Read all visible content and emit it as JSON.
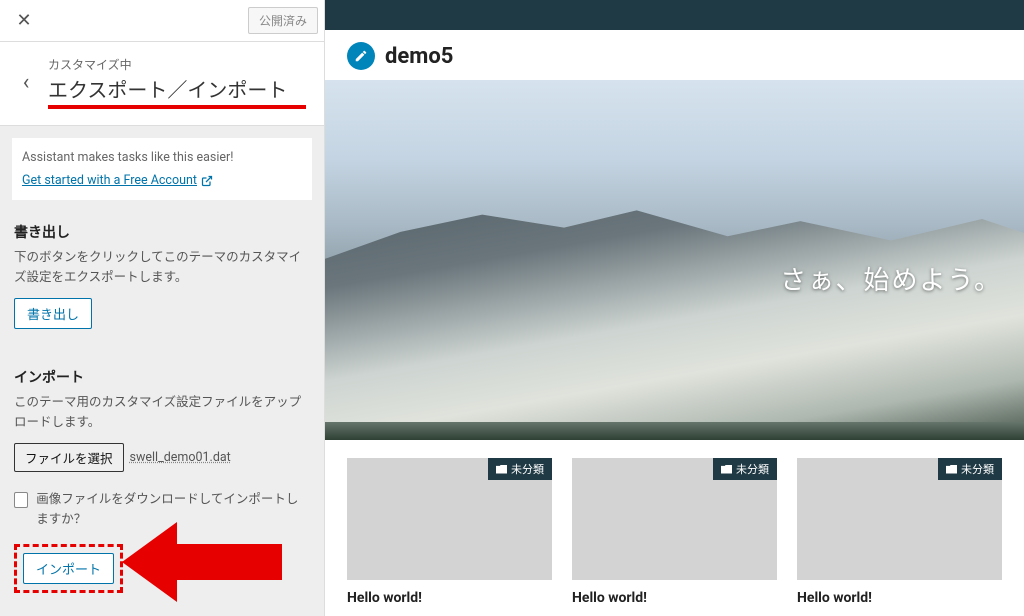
{
  "header": {
    "publish_label": "公開済み"
  },
  "panel": {
    "breadcrumb": "カスタマイズ中",
    "title": "エクスポート／インポート"
  },
  "assistant": {
    "text": "Assistant makes tasks like this easier!",
    "link": "Get started with a Free Account"
  },
  "export": {
    "heading": "書き出し",
    "desc": "下のボタンをクリックしてこのテーマのカスタマイズ設定をエクスポートします。",
    "button": "書き出し"
  },
  "import": {
    "heading": "インポート",
    "desc": "このテーマ用のカスタマイズ設定ファイルをアップロードします。",
    "choose_file": "ファイルを選択",
    "file_name": "swell_demo01.dat",
    "download_images": "画像ファイルをダウンロードしてインポートしますか？",
    "button": "インポート"
  },
  "preview": {
    "site_name": "demo5",
    "hero_caption": "さぁ、始めよう。",
    "badge": "未分類",
    "post_title": "Hello world!"
  }
}
